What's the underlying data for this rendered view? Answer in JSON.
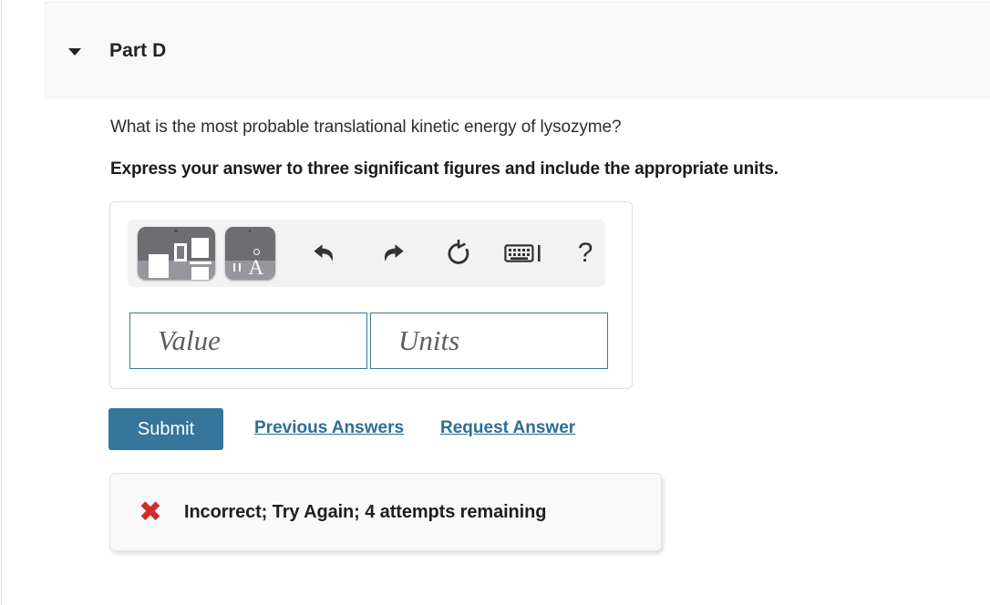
{
  "header": {
    "title": "Part D",
    "caret_icon": "caret-down-icon",
    "expanded": true
  },
  "question": {
    "prompt": "What is the most probable translational kinetic energy of lysozyme?",
    "instruction": "Express your answer to three significant figures and include the appropriate units."
  },
  "answer_box": {
    "toolbar": {
      "buttons": [
        {
          "name": "template-button",
          "icon": "math-template-icon",
          "label": "Math templates"
        },
        {
          "name": "units-button",
          "icon": "angstrom-units-icon",
          "label": "Units and symbols"
        }
      ],
      "actions": [
        {
          "name": "undo-button",
          "icon": "undo-arrow-icon",
          "label": "Undo"
        },
        {
          "name": "redo-button",
          "icon": "redo-arrow-icon",
          "label": "Redo"
        },
        {
          "name": "reset-button",
          "icon": "reset-circular-arrow-icon",
          "label": "Reset"
        },
        {
          "name": "keyboard-button",
          "icon": "keyboard-icon",
          "label": "Keyboard shortcuts"
        },
        {
          "name": "help-button",
          "icon": "question-mark-icon",
          "label": "Help",
          "glyph": "?"
        }
      ]
    },
    "fields": {
      "value_placeholder": "Value",
      "value": "",
      "units_placeholder": "Units",
      "units": ""
    }
  },
  "actions": {
    "submit_label": "Submit",
    "previous_answers_label": "Previous Answers",
    "request_answer_label": "Request Answer"
  },
  "feedback": {
    "status_icon": "x-mark-icon",
    "glyph": "✖",
    "message": "Incorrect; Try Again; 4 attempts remaining"
  },
  "colors": {
    "submit_background": "#36769a",
    "link": "#2d6e94",
    "header_background": "#f8f8f8",
    "input_border": "#3c7897",
    "error": "#d12b2b",
    "feedback_background": "#f9f9f9"
  }
}
